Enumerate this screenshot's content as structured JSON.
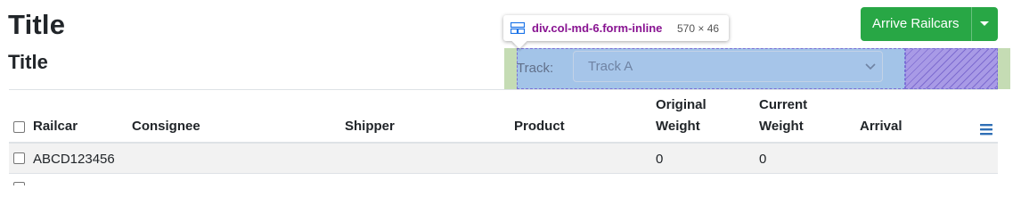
{
  "page": {
    "title": "Title",
    "subtitle": "Title"
  },
  "devtools_tooltip": {
    "selector": "div.col-md-6.form-inline",
    "size": "570 × 46"
  },
  "filter": {
    "track_label": "Track:",
    "track_value": "Track A"
  },
  "actions": {
    "arrive_label": "Arrive Railcars"
  },
  "table": {
    "columns": {
      "railcar": "Railcar",
      "consignee": "Consignee",
      "shipper": "Shipper",
      "product": "Product",
      "original_weight_1": "Original",
      "original_weight_2": "Weight",
      "current_weight_1": "Current",
      "current_weight_2": "Weight",
      "arrival": "Arrival"
    },
    "rows": [
      {
        "railcar": "ABCD123456",
        "consignee": "",
        "shipper": "",
        "product": "",
        "original_weight": "0",
        "current_weight": "0",
        "arrival": ""
      }
    ]
  },
  "colors": {
    "accent_green": "#28a745",
    "highlight_content": "#a3c4e8",
    "highlight_padding": "#a89ae6",
    "highlight_margin": "#c5dcb4",
    "selector_purple": "#881391"
  },
  "icons": {
    "layout": "grid-icon",
    "select_arrow": "chevron-down-icon",
    "dropdown": "caret-down-icon",
    "column_menu": "hamburger-menu-icon"
  }
}
